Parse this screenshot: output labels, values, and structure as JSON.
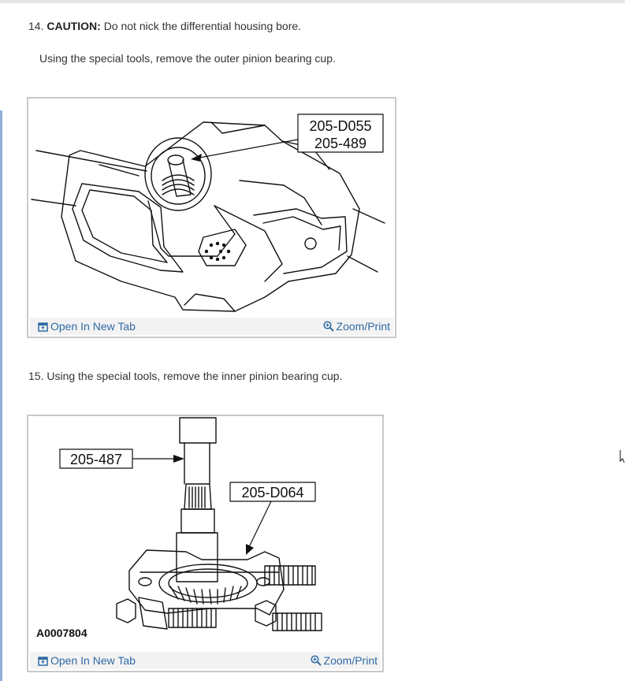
{
  "step14": {
    "number": "14.",
    "caution_label": "CAUTION:",
    "caution_text": "Do not nick the differential housing bore.",
    "instruction": "Using the special tools, remove the outer pinion bearing cup."
  },
  "figure1": {
    "callout_line1": "205-D055",
    "callout_line2": "205-489",
    "open_new_tab": "Open In New Tab",
    "zoom_print": "Zoom/Print"
  },
  "step15": {
    "text": "15. Using the special tools, remove the inner pinion bearing cup."
  },
  "figure2": {
    "callout_a": "205-487",
    "callout_b": "205-D064",
    "figure_id": "A0007804",
    "open_new_tab": "Open In New Tab",
    "zoom_print": "Zoom/Print"
  },
  "colors": {
    "link": "#2f6aa3",
    "toolbar_bg": "#f3f3f3",
    "border": "#c9c9c9"
  },
  "icons": {
    "open_tab": "open-new-tab-icon",
    "zoom": "zoom-magnifier-icon"
  }
}
